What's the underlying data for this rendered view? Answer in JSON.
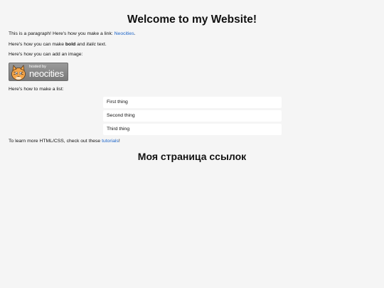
{
  "header": {
    "title": "Welcome to my Website!"
  },
  "intro": {
    "p1_text": "This is a paragraph! Here's how you make a link: ",
    "p1_link": "Neocities",
    "p1_end": ".",
    "p2_start": "Here's how you can make ",
    "p2_bold": "bold",
    "p2_mid": " and ",
    "p2_italic": "italic",
    "p2_end": " text.",
    "p3_text": "Here's how you can add an image:"
  },
  "badge": {
    "small_text": "hosted by",
    "big_text": "neocities",
    "icon": "neocities-cat-icon"
  },
  "list": {
    "intro": "Here's how to make a list:",
    "items": [
      "First thing",
      "Second thing",
      "Third thing"
    ]
  },
  "footer_text": {
    "start": "To learn more HTML/CSS, check out these ",
    "link": "tutorials",
    "end": "!"
  },
  "section": {
    "title": "Моя страница ссылок"
  },
  "colors": {
    "background": "#f5f5f5",
    "link": "#1a63c8",
    "list_bg": "#ffffff"
  }
}
